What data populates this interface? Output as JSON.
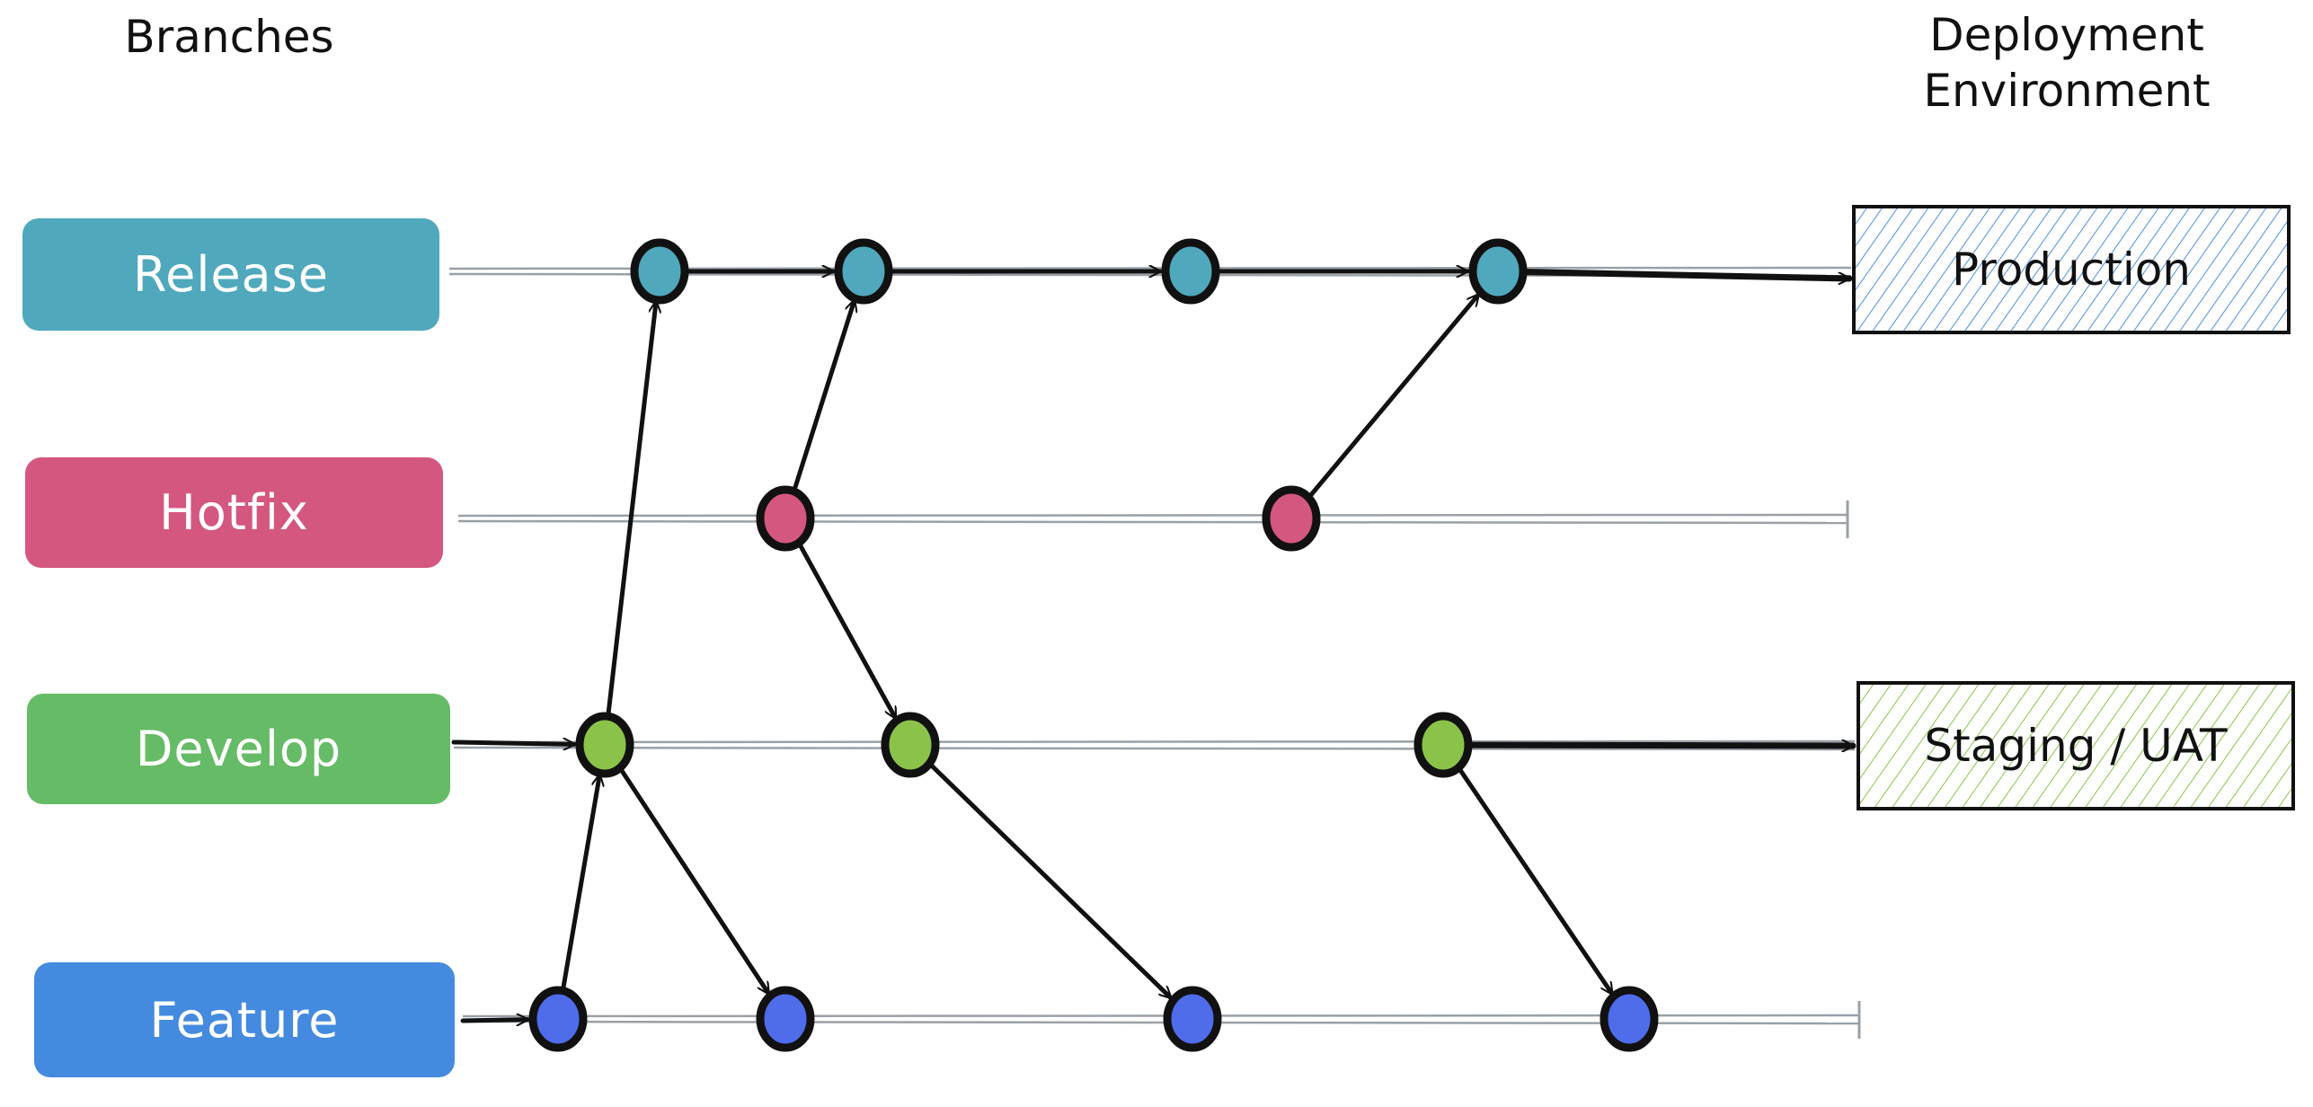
{
  "headings": {
    "branches": "Branches",
    "deployment": [
      "Deployment",
      "Environment"
    ]
  },
  "branches": [
    {
      "id": "release",
      "label": "Release",
      "color": "#4FA8BC",
      "node_color": "#4FA8BC"
    },
    {
      "id": "hotfix",
      "label": "Hotfix",
      "color": "#D4577F",
      "node_color": "#D4577F"
    },
    {
      "id": "develop",
      "label": "Develop",
      "color": "#66BB66",
      "node_color": "#8BC34A"
    },
    {
      "id": "feature",
      "label": "Feature",
      "color": "#448ADF",
      "node_color": "#4F6CEB"
    }
  ],
  "environments": [
    {
      "id": "production",
      "label": "Production",
      "hatch_color": "#4A90E2",
      "fed_by": "release"
    },
    {
      "id": "staging",
      "label": "Staging / UAT",
      "hatch_color": "#8BC34A",
      "fed_by": "develop"
    }
  ],
  "commits": [
    {
      "id": "r1",
      "branch": "release",
      "seq": 2
    },
    {
      "id": "r2",
      "branch": "release",
      "seq": 4
    },
    {
      "id": "r3",
      "branch": "release",
      "seq": 6
    },
    {
      "id": "r4",
      "branch": "release",
      "seq": 9
    },
    {
      "id": "h1",
      "branch": "hotfix",
      "seq": 3
    },
    {
      "id": "h2",
      "branch": "hotfix",
      "seq": 8
    },
    {
      "id": "d1",
      "branch": "develop",
      "seq": 1
    },
    {
      "id": "d2",
      "branch": "develop",
      "seq": 5
    },
    {
      "id": "d3",
      "branch": "develop",
      "seq": 7
    },
    {
      "id": "f1",
      "branch": "feature",
      "seq": 0
    },
    {
      "id": "f2",
      "branch": "feature",
      "seq": 3
    },
    {
      "id": "f3",
      "branch": "feature",
      "seq": 6
    },
    {
      "id": "f4",
      "branch": "feature",
      "seq": 10
    }
  ],
  "edges": [
    {
      "from": "f1",
      "to": "d1"
    },
    {
      "from": "d1",
      "to": "r1"
    },
    {
      "from": "d1",
      "to": "f2"
    },
    {
      "from": "r1",
      "to": "r2"
    },
    {
      "from": "h1",
      "to": "r2"
    },
    {
      "from": "h1",
      "to": "d2"
    },
    {
      "from": "d2",
      "to": "f3"
    },
    {
      "from": "r2",
      "to": "r3"
    },
    {
      "from": "r3",
      "to": "r4"
    },
    {
      "from": "h2",
      "to": "r4"
    },
    {
      "from": "d3",
      "to": "f4"
    },
    {
      "from": "r4",
      "to": "production"
    },
    {
      "from": "d3",
      "to": "staging"
    },
    {
      "from": "develop-start",
      "to": "d1"
    },
    {
      "from": "feature-start",
      "to": "f1"
    }
  ]
}
